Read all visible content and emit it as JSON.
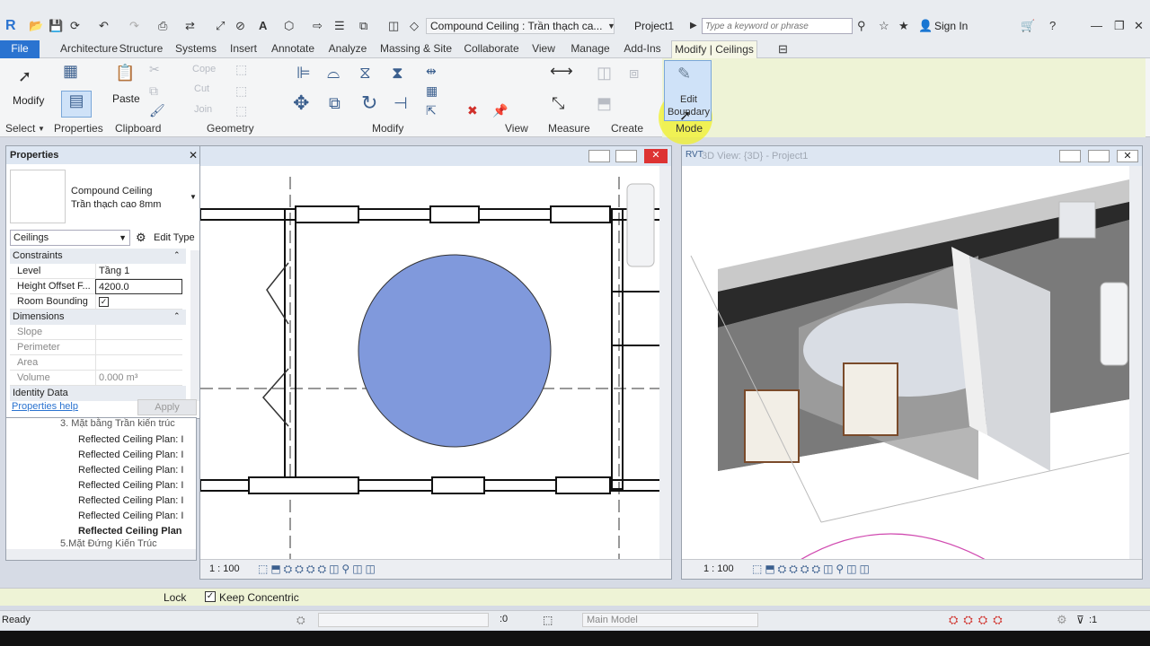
{
  "qat": {
    "logo": "R",
    "title_combo": "Compound Ceiling : Trần thạch ca...",
    "project": "Project1",
    "search_placeholder": "Type a keyword or phrase",
    "sign_in": "Sign In"
  },
  "tabs": [
    "File",
    "Architecture",
    "Structure",
    "Systems",
    "Insert",
    "Annotate",
    "Analyze",
    "Massing & Site",
    "Collaborate",
    "View",
    "Manage",
    "Add-Ins",
    "Modify | Ceilings"
  ],
  "ribbon": {
    "modify": "Modify",
    "paste": "Paste",
    "cope": "Cope",
    "cut": "Cut",
    "join": "Join",
    "edit_boundary_1": "Edit",
    "edit_boundary_2": "Boundary",
    "panels": {
      "select": "Select",
      "properties": "Properties",
      "clipboard": "Clipboard",
      "geometry": "Geometry",
      "modify": "Modify",
      "view": "View",
      "measure": "Measure",
      "create": "Create",
      "mode": "Mode"
    }
  },
  "properties": {
    "title": "Properties",
    "type_line1": "Compound Ceiling",
    "type_line2": "Trần thạch cao 8mm",
    "category": "Ceilings",
    "edit_type": "Edit Type",
    "sections": {
      "constraints": "Constraints",
      "dimensions": "Dimensions",
      "identity": "Identity Data"
    },
    "level_k": "Level",
    "level_v": "Tầng 1",
    "height_k": "Height Offset F...",
    "height_v": "4200.0",
    "room_k": "Room Bounding",
    "slope_k": "Slope",
    "perimeter_k": "Perimeter",
    "area_k": "Area",
    "volume_k": "Volume",
    "volume_v": "0.000 m³",
    "help": "Properties help",
    "apply": "Apply"
  },
  "browser": {
    "item_top": "3. Mặt bằng Trần kiến trúc",
    "items": [
      "Reflected Ceiling Plan: I",
      "Reflected Ceiling Plan: I",
      "Reflected Ceiling Plan: I",
      "Reflected Ceiling Plan: I",
      "Reflected Ceiling Plan: I",
      "Reflected Ceiling Plan: I"
    ],
    "item_bold": "Reflected Ceiling Plan",
    "item_bottom": "5.Mặt Đứng Kiến Trúc"
  },
  "view2": {
    "title": "3D View: {3D} - Project1"
  },
  "viewbar": {
    "scale1": "1 : 100",
    "scale2": "1 : 100"
  },
  "options": {
    "lock": "Lock",
    "keep": "Keep Concentric"
  },
  "status": {
    "ready": "Ready",
    "zero": ":0",
    "model": "Main Model",
    "filter": ":1"
  },
  "colors": {
    "accent": "#2a73d0",
    "ceiling": "#8099dc",
    "mode": "#eef3d6"
  }
}
